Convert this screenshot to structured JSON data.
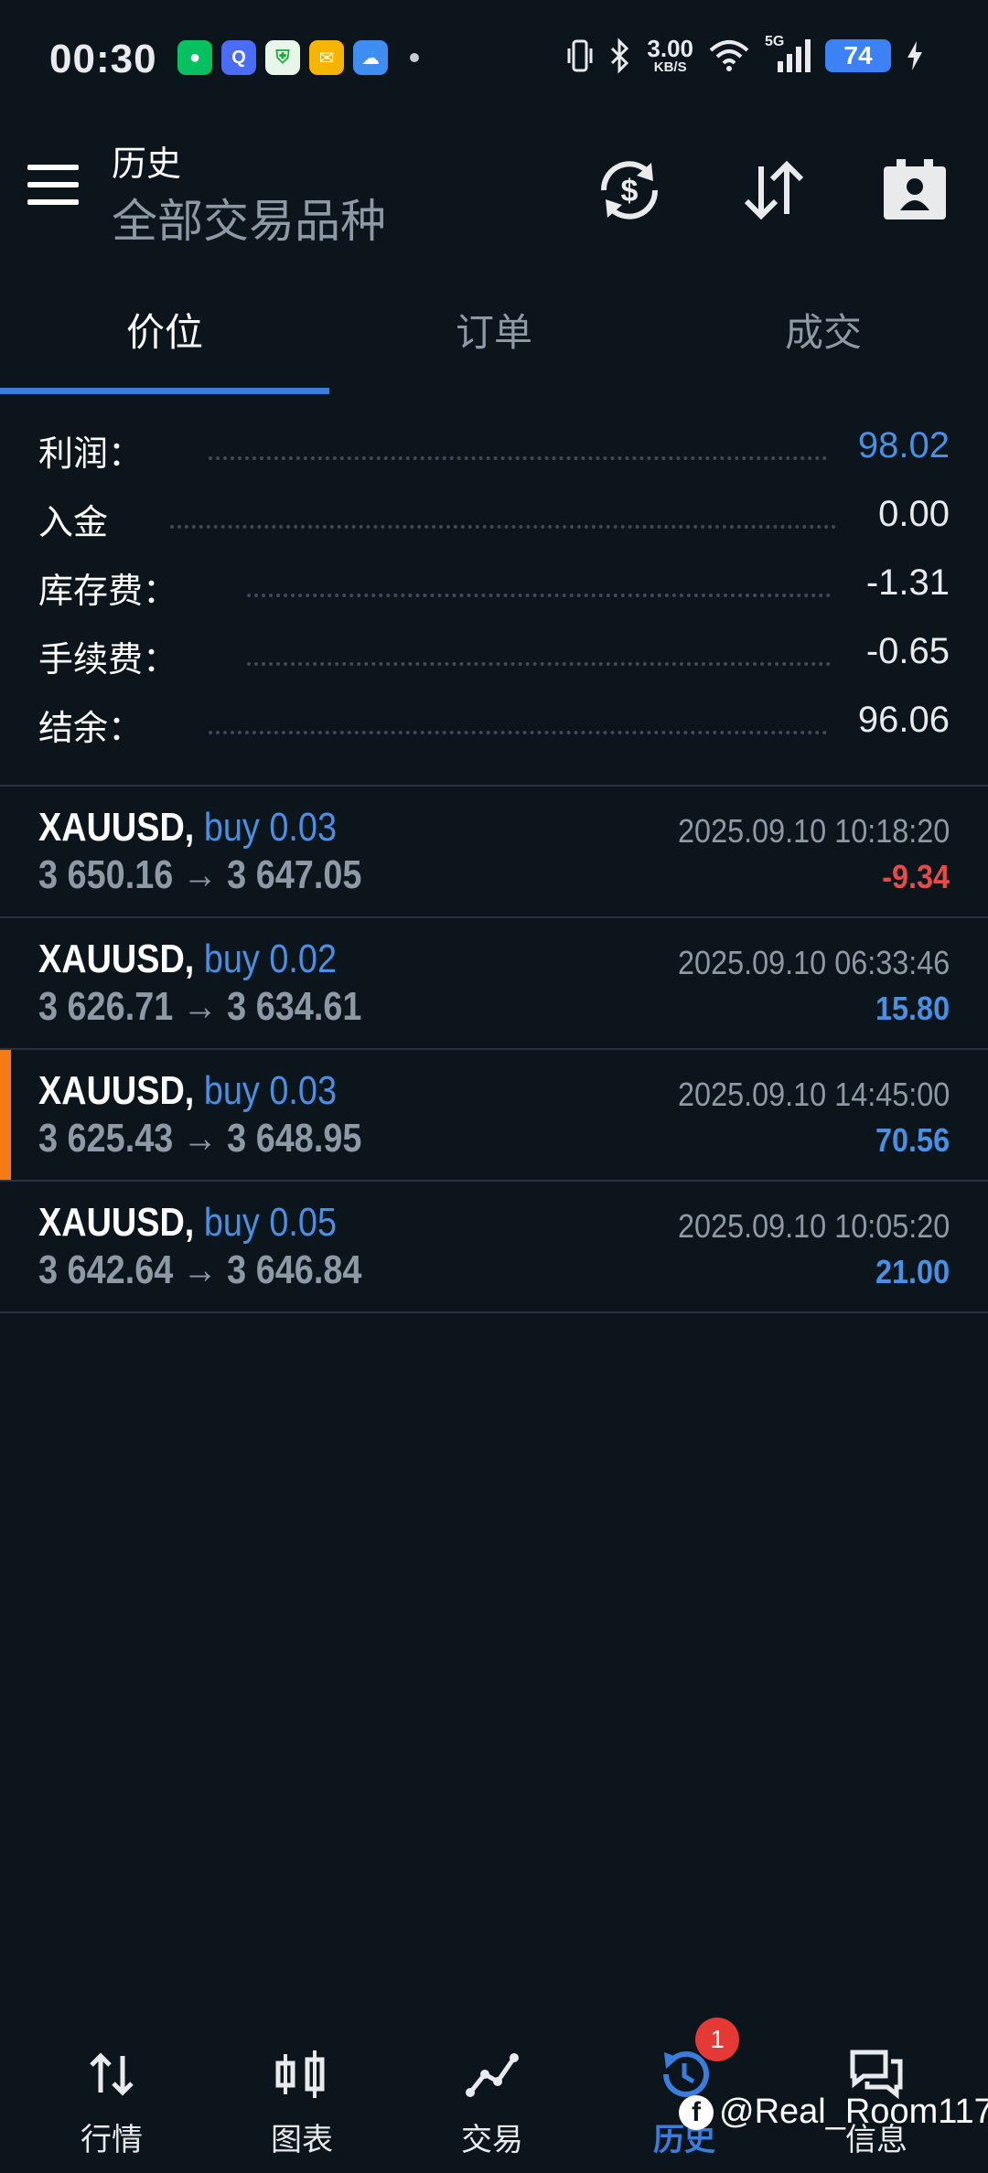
{
  "status_bar": {
    "time": "00:30",
    "net_speed": "3.00",
    "net_unit": "KB/S",
    "network": "5G",
    "battery": "74"
  },
  "header": {
    "title": "历史",
    "subtitle": "全部交易品种"
  },
  "tabs": [
    {
      "label": "价位",
      "active": true
    },
    {
      "label": "订单",
      "active": false
    },
    {
      "label": "成交",
      "active": false
    }
  ],
  "summary": [
    {
      "label": "利润：",
      "value": "98.02"
    },
    {
      "label": "入金",
      "value": "0.00"
    },
    {
      "label": "库存费：",
      "value": "-1.31"
    },
    {
      "label": "手续费：",
      "value": "-0.65"
    },
    {
      "label": "结余：",
      "value": "96.06"
    }
  ],
  "deals": [
    {
      "symbol": "XAUUSD,",
      "side": "buy 0.03",
      "prices": "3 650.16 → 3 647.05",
      "time": "2025.09.10 10:18:20",
      "profit": "-9.34",
      "profit_color": "#e84a4a",
      "marked": false
    },
    {
      "symbol": "XAUUSD,",
      "side": "buy 0.02",
      "prices": "3 626.71 → 3 634.61",
      "time": "2025.09.10 06:33:46",
      "profit": "15.80",
      "profit_color": "#4a90e2",
      "marked": false
    },
    {
      "symbol": "XAUUSD,",
      "side": "buy 0.03",
      "prices": "3 625.43 → 3 648.95",
      "time": "2025.09.10 14:45:00",
      "profit": "70.56",
      "profit_color": "#4a90e2",
      "marked": true
    },
    {
      "symbol": "XAUUSD,",
      "side": "buy 0.05",
      "prices": "3 642.64 → 3 646.84",
      "time": "2025.09.10 10:05:20",
      "profit": "21.00",
      "profit_color": "#4a90e2",
      "marked": false
    }
  ],
  "bottom_nav": [
    {
      "label": "行情",
      "icon": "quotes-icon"
    },
    {
      "label": "图表",
      "icon": "chart-icon"
    },
    {
      "label": "交易",
      "icon": "trade-icon"
    },
    {
      "label": "历史",
      "icon": "history-icon",
      "active": true
    },
    {
      "label": "信息",
      "icon": "messages-icon"
    }
  ],
  "messages_badge": "1",
  "watermark": "@Real_Room117",
  "colors": {
    "background": "#0c141c",
    "accent": "#3b7ddd",
    "profit_positive": "#4a90e2",
    "profit_negative": "#e84a4a",
    "marker": "#f57c14"
  }
}
